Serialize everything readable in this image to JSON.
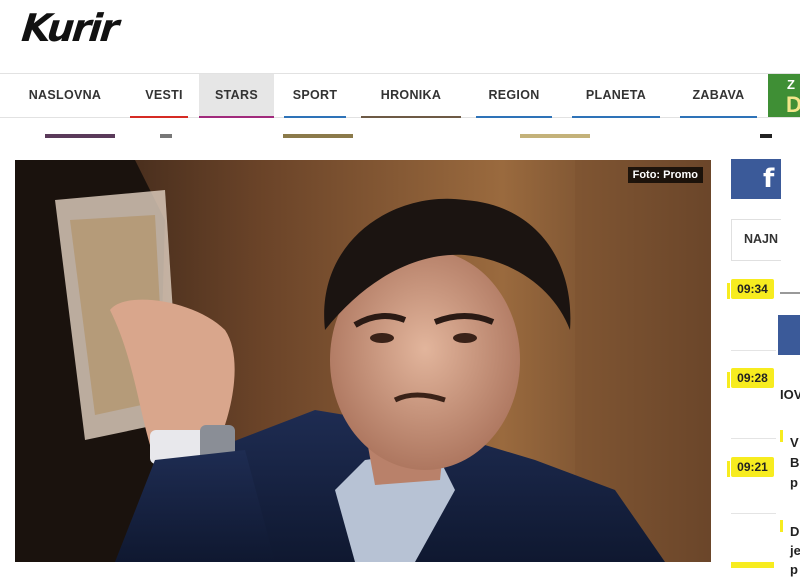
{
  "logo": {
    "text": "Kurir"
  },
  "nav": {
    "items": [
      {
        "label": "NASLOVNA",
        "bar_color": "#d62b24"
      },
      {
        "label": "VESTI",
        "bar_color": "#d62b24"
      },
      {
        "label": "STARS",
        "bar_color": "#a12a7c",
        "active": true
      },
      {
        "label": "SPORT",
        "bar_color": "#2e73b8"
      },
      {
        "label": "HRONIKA",
        "bar_color": "#6d5a45"
      },
      {
        "label": "REGION",
        "bar_color": "#2e73b8"
      },
      {
        "label": "PLANETA",
        "bar_color": "#2e73b8"
      },
      {
        "label": "ZABAVA",
        "bar_color": "#2e73b8"
      }
    ],
    "promo": {
      "line1": "Z",
      "line2": "D"
    }
  },
  "hero": {
    "photo_credit": "Foto: Promo"
  },
  "sidebar": {
    "social_icon": "facebook-icon",
    "tab_label": "NAJN",
    "times": [
      "09:34",
      "09:28",
      "09:21"
    ],
    "fragments": [
      "IOV",
      "V",
      "B",
      "p",
      "D",
      "je",
      "p"
    ]
  },
  "colors": {
    "accent_yellow": "#f7ec1f",
    "facebook_blue": "#3b5a99",
    "promo_green": "#3f8f35"
  }
}
